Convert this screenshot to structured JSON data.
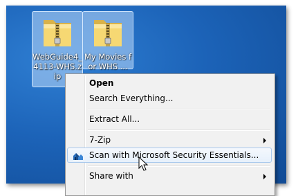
{
  "desktop": {
    "icons": [
      {
        "label": "WebGuide4_4113-WHS.zip",
        "icon": "zip-folder-icon"
      },
      {
        "label": "My Movies for WHS ...",
        "icon": "zip-folder-icon"
      }
    ]
  },
  "context_menu": {
    "items": [
      {
        "label": "Open",
        "bold": true
      },
      {
        "label": "Search Everything..."
      },
      {
        "label": "Extract All..."
      },
      {
        "label": "7-Zip",
        "submenu": true
      },
      {
        "label": "Scan with Microsoft Security Essentials...",
        "icon": "security-essentials-icon",
        "hovered": true
      },
      {
        "label": "Share with",
        "submenu": true
      }
    ]
  },
  "colors": {
    "desktop_bg": "#1c63b8",
    "menu_bg": "#f1f1f1",
    "hover_border": "#a8c8ec"
  }
}
